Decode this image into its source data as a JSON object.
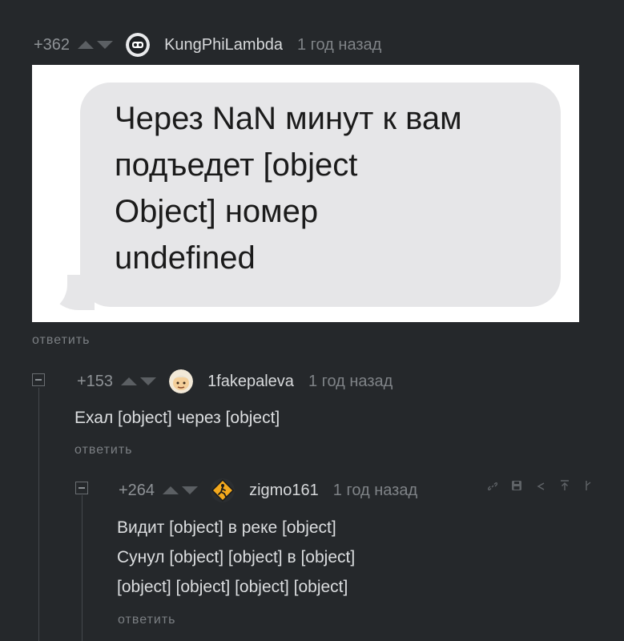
{
  "post": {
    "rating": "+362",
    "username": "KungPhiLambda",
    "time": "1 год назад",
    "image_text": [
      "Через NaN минут к вам",
      "подъедет [object",
      "Object] номер",
      "undefined"
    ],
    "reply_label": "ответить"
  },
  "comments": [
    {
      "rating": "+153",
      "username": "1fakepaleva",
      "time": "1 год назад",
      "lines": [
        "Ехал [object] через [object]"
      ],
      "reply_label": "ответить"
    },
    {
      "rating": "+264",
      "username": "zigmo161",
      "time": "1 год назад",
      "lines": [
        "Видит [object] в реке [object]",
        "Сунул [object] [object] в [object]",
        "[object] [object] [object] [object]"
      ],
      "reply_label": "ответить"
    }
  ],
  "tool_icons": [
    "link-icon",
    "save-icon",
    "share-icon",
    "pin-to-top-icon",
    "more-icon"
  ],
  "colors": {
    "background": "#25282b",
    "text": "#dcdee0",
    "muted": "#7f8387"
  }
}
